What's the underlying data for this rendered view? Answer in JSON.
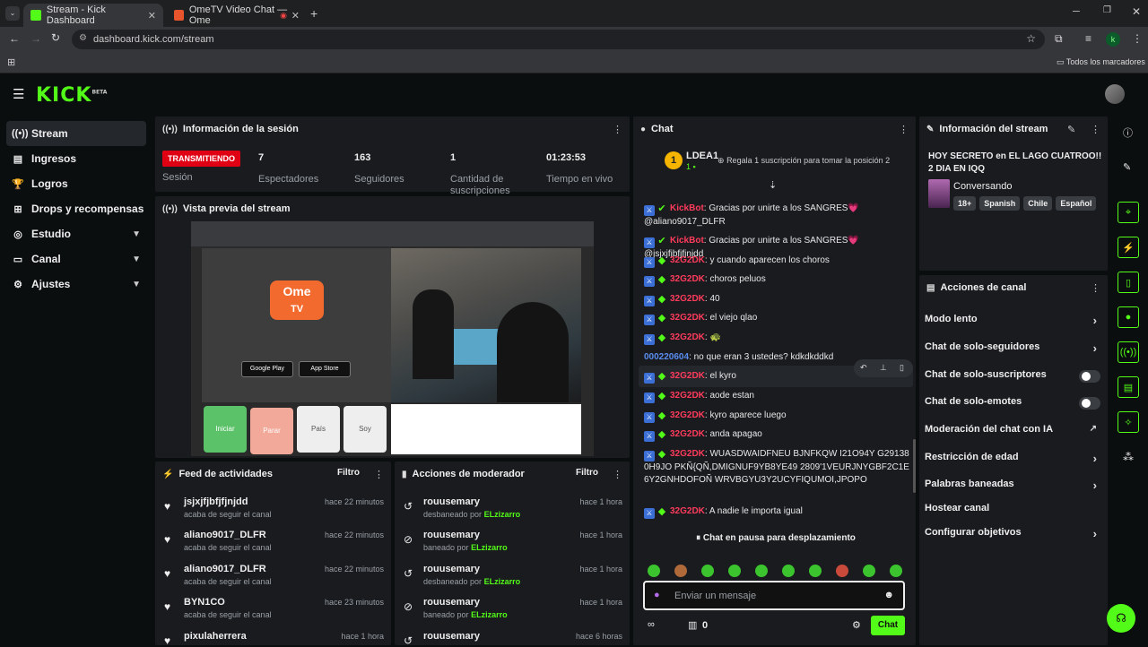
{
  "browser": {
    "tabs": [
      {
        "label": "Stream - Kick Dashboard"
      },
      {
        "label": "OmeTV Video Chat — Ome"
      }
    ],
    "url": "dashboard.kick.com/stream",
    "bookmarks_label": "Todos los marcadores",
    "profile_initial": "k"
  },
  "app": {
    "logo": "KICK",
    "logo_sup": "BETA"
  },
  "sidebar": {
    "items": [
      {
        "label": "Stream"
      },
      {
        "label": "Ingresos"
      },
      {
        "label": "Logros"
      },
      {
        "label": "Drops y recompensas"
      },
      {
        "label": "Estudio"
      },
      {
        "label": "Canal"
      },
      {
        "label": "Ajustes"
      }
    ]
  },
  "session": {
    "title": "Información de la sesión",
    "status": "TRANSMITIENDO",
    "status_label": "Sesión",
    "stats": [
      {
        "value": "7",
        "label": "Espectadores"
      },
      {
        "value": "163",
        "label": "Seguidores"
      },
      {
        "value": "1",
        "label": "Cantidad de suscripciones"
      },
      {
        "value": "01:23:53",
        "label": "Tiempo en vivo"
      }
    ]
  },
  "preview": {
    "title": "Vista previa del stream",
    "ome_logo": "Ome",
    "ome_sub": "TV",
    "google_play": "Google Play",
    "app_store": "App Store",
    "btn_start": "Iniciar",
    "btn_stop": "Parar",
    "btn_country": "País",
    "btn_gender": "Soy"
  },
  "activity": {
    "title": "Feed de actividades",
    "filter": "Filtro",
    "rows": [
      {
        "name": "jsjxjfjbfjfjnjdd",
        "sub": "acaba de seguir el canal",
        "time": "hace 22 minutos"
      },
      {
        "name": "aliano9017_DLFR",
        "sub": "acaba de seguir el canal",
        "time": "hace 22 minutos"
      },
      {
        "name": "aliano9017_DLFR",
        "sub": "acaba de seguir el canal",
        "time": "hace 22 minutos"
      },
      {
        "name": "BYN1CO",
        "sub": "acaba de seguir el canal",
        "time": "hace 23 minutos"
      },
      {
        "name": "pixulaherrera",
        "sub": "",
        "time": "hace 1 hora"
      }
    ]
  },
  "moderation": {
    "title": "Acciones de moderador",
    "filter": "Filtro",
    "rows": [
      {
        "name": "rouusemary",
        "action": "desbaneado por",
        "by": "ELzizarro",
        "time": "hace 1 hora"
      },
      {
        "name": "rouusemary",
        "action": "baneado por",
        "by": "ELzizarro",
        "time": "hace 1 hora"
      },
      {
        "name": "rouusemary",
        "action": "desbaneado por",
        "by": "ELzizarro",
        "time": "hace 1 hora"
      },
      {
        "name": "rouusemary",
        "action": "baneado por",
        "by": "ELzizarro",
        "time": "hace 1 hora"
      },
      {
        "name": "rouusemary",
        "action": "",
        "by": "",
        "time": "hace 6 horas"
      }
    ]
  },
  "chat": {
    "title": "Chat",
    "leader_rank": "1",
    "leader_name": "LDEA1",
    "leader_count": "1",
    "gift_prompt": "Regala 1 suscripción para tomar la posición 2",
    "messages": [
      {
        "user": "KickBot",
        "text": ": Gracias por unirte a los SANGRES💗 @aliano9017_DLFR"
      },
      {
        "user": "KickBot",
        "text": ": Gracias por unirte a los SANGRES💗 @jsjxjfjbfjfjnjdd"
      },
      {
        "user": "32G2DK",
        "text": ": y cuando aparecen los choros"
      },
      {
        "user": "32G2DK",
        "text": ": choros peluos"
      },
      {
        "user": "32G2DK",
        "text": ": 40"
      },
      {
        "user": "32G2DK",
        "text": ": el viejo qlao"
      },
      {
        "user": "32G2DK",
        "text": ": 🐢"
      },
      {
        "user": "000220604",
        "text": ": no que eran 3 ustedes? kdkdkddkd"
      },
      {
        "user": "32G2DK",
        "text": ": el kyro"
      },
      {
        "user": "32G2DK",
        "text": ": aode estan"
      },
      {
        "user": "32G2DK",
        "text": ": kyro aparece luego"
      },
      {
        "user": "32G2DK",
        "text": ": anda apagao"
      },
      {
        "user": "32G2DK",
        "text": ": WUASDWAIDFNEU BJNFKQW I21O94Y G291380H9JO PKÑ{QÑ,DMIGNUF9YB8YE49 2809'1VEURJNYGBF2C1E6Y2GNHDOFOÑ WRVBGYU3Y2UCYFIQUMOI,JPOPO"
      },
      {
        "user": "32G2DK",
        "text": ": A nadie le importa igual"
      }
    ],
    "paused": "Chat en pausa para desplazamiento",
    "input_placeholder": "Enviar un mensaje",
    "points": "0",
    "send": "Chat"
  },
  "stream_info": {
    "title": "Información del stream",
    "stream_title": "HOY SECRETO en EL LAGO CUATROO!! 2 DIA EN IQQ",
    "category": "Conversando",
    "tags": [
      "18+",
      "Spanish",
      "Chile",
      "Español"
    ]
  },
  "channel_actions": {
    "title": "Acciones de canal",
    "items": [
      {
        "label": "Modo lento"
      },
      {
        "label": "Chat de solo-seguidores"
      },
      {
        "label": "Chat de solo-suscriptores"
      },
      {
        "label": "Chat de solo-emotes"
      },
      {
        "label": "Moderación del chat con IA"
      },
      {
        "label": "Restricción de edad"
      },
      {
        "label": "Palabras baneadas"
      },
      {
        "label": "Hostear canal"
      },
      {
        "label": "Configurar objetivos"
      }
    ]
  },
  "colors": {
    "brand": "#53fc18",
    "live": "#e00014",
    "panel": "#191b1f"
  }
}
